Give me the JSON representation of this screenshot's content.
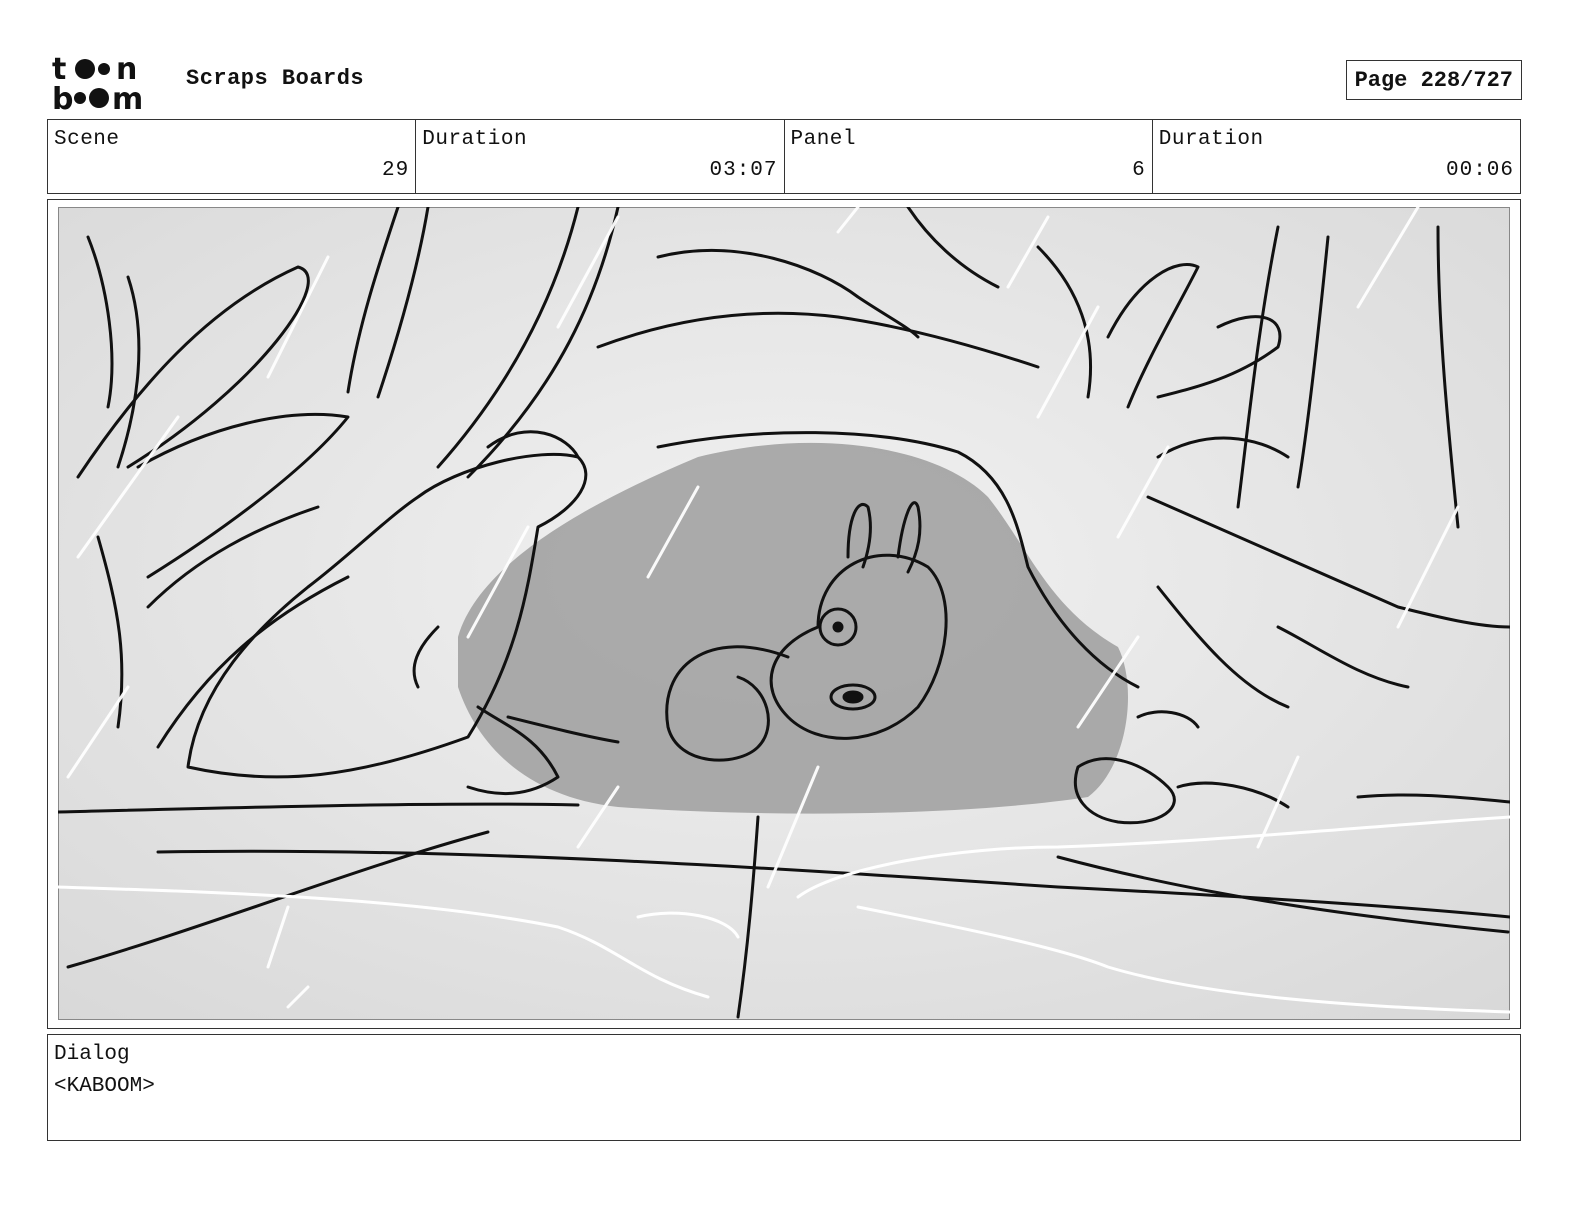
{
  "header": {
    "logo_text": "toon boom",
    "title": "Scraps Boards",
    "page": "Page 228/727"
  },
  "info": [
    {
      "label": "Scene",
      "value": "29"
    },
    {
      "label": "Duration",
      "value": "03:07"
    },
    {
      "label": "Panel",
      "value": "6"
    },
    {
      "label": "Duration",
      "value": "00:06"
    }
  ],
  "panel": {
    "icon": "storyboard-sketch-image",
    "description_icon": "squirrel-in-burrow-sketch"
  },
  "dialog": {
    "label": "Dialog",
    "text": "<KABOOM>"
  },
  "colors": {
    "border": "#333333",
    "sketch_bg": "#e2e2e2",
    "burrow_shadow": "#9a9a9a",
    "ink": "#111111"
  }
}
